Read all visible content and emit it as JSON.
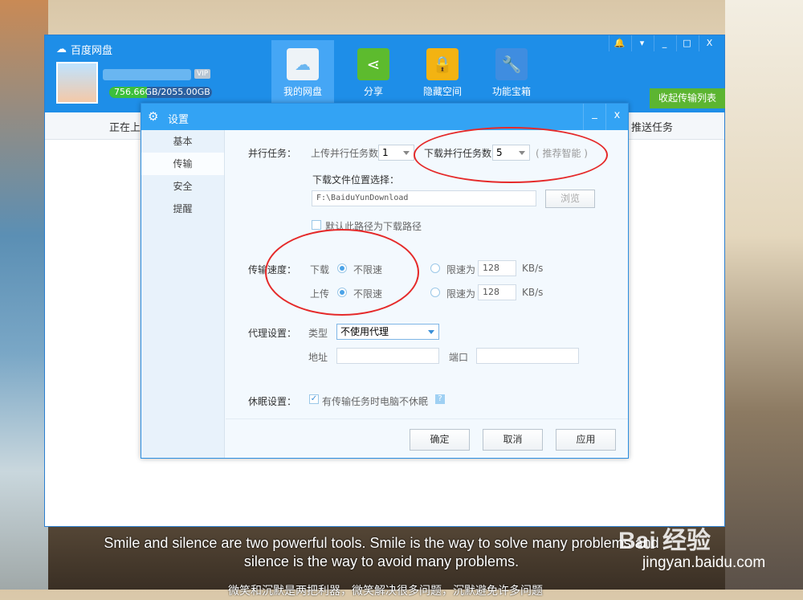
{
  "app": {
    "title": "百度网盘",
    "quota": "756.66GB/2055.00GB",
    "quota_fraction": 0.368,
    "vip": "VIP",
    "nav": [
      {
        "label": "我的网盘",
        "icon": "cloud-icon"
      },
      {
        "label": "分享",
        "icon": "share-icon"
      },
      {
        "label": "隐藏空间",
        "icon": "lock-icon"
      },
      {
        "label": "功能宝箱",
        "icon": "wrench-icon"
      }
    ],
    "window_buttons": [
      "🔔",
      "▾",
      "_",
      "□",
      "X"
    ],
    "collapse_label": "收起传输列表",
    "subbar_left": "正在上",
    "subbar_right": "推送任务"
  },
  "dialog": {
    "title": "设置",
    "min": "_",
    "close": "x",
    "sidebar": [
      "基本",
      "传输",
      "安全",
      "提醒"
    ],
    "parallel": {
      "label": "并行任务：",
      "upload_label": "上传并行任务数",
      "upload_value": "1",
      "download_label": "下载并行任务数",
      "download_value": "5",
      "hint": "( 推荐智能 )"
    },
    "location": {
      "label": "下载文件位置选择：",
      "path": "F:\\BaiduYunDownload",
      "browse": "浏览",
      "default_label": "默认此路径为下载路径"
    },
    "speed": {
      "label": "传输速度：",
      "download": "下载",
      "upload": "上传",
      "unlimited": "不限速",
      "limit": "限速为",
      "download_limit": "128",
      "upload_limit": "128",
      "unit": "KB/s"
    },
    "proxy": {
      "label": "代理设置：",
      "type_label": "类型",
      "type_value": "不使用代理",
      "address_label": "地址",
      "port_label": "端口"
    },
    "sleep": {
      "label": "休眠设置：",
      "option": "有传输任务时电脑不休眠",
      "help": "?"
    },
    "buttons": {
      "ok": "确定",
      "cancel": "取消",
      "apply": "应用"
    }
  },
  "caption": {
    "line1": "Smile and silence are two powerful tools. Smile is the way to solve many problems and",
    "line2": "silence is the way to avoid many problems.",
    "line3": "微笑和沉默是两把利器，微笑解决很多问题，沉默避免许多问题"
  },
  "watermark": {
    "brand": "Bai 经验",
    "url": "jingyan.baidu.com"
  }
}
